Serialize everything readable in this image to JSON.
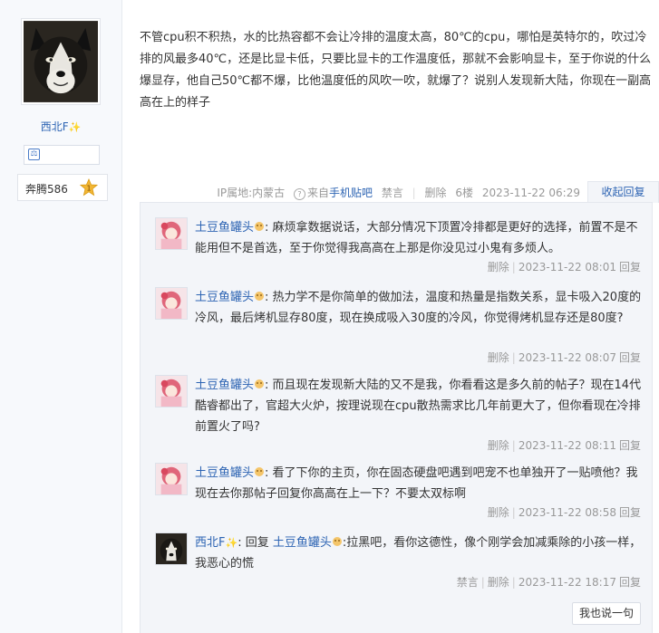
{
  "author": {
    "name": "西北F",
    "level_name": "奔腾586",
    "level_number": "1"
  },
  "post": {
    "body": "不管cpu积不积热，水的比热容都不会让冷排的温度太高，80℃的cpu，哪怕是英特尔的，吹过冷排的风最多40℃，还是比显卡低，只要比显卡的工作温度低，那就不会影响显卡，至于你说的什么爆显存，他自己50℃都不爆，比他温度低的风吹一吹，就爆了？说别人发现新大陆，你现在一副高高在上的样子",
    "ip_location": "IP属地:内蒙古",
    "source_prefix": "来自",
    "source_link": "手机贴吧",
    "ban": "禁言",
    "delete": "删除",
    "floor": "6楼",
    "time": "2023-11-22 06:29",
    "collapse_reply": "收起回复"
  },
  "replies": [
    {
      "user": "土豆鱼罐头",
      "text": ": 麻烦拿数据说话，大部分情况下顶置冷排都是更好的选择，前置不是不能用但不是首选，至于你觉得我高高在上那是你没见过小鬼有多烦人。",
      "delete": "删除",
      "time": "2023-11-22 08:01",
      "reply": "回复"
    },
    {
      "user": "土豆鱼罐头",
      "text": ": 热力学不是你简单的做加法，温度和热量是指数关系，显卡吸入20度的冷风，最后烤机显存80度，现在换成吸入30度的冷风，你觉得烤机显存还是80度?",
      "delete": "删除",
      "time": "2023-11-22 08:07",
      "reply": "回复"
    },
    {
      "user": "土豆鱼罐头",
      "text": ": 而且现在发现新大陆的又不是我，你看看这是多久前的帖子？现在14代酷睿都出了，官超大火炉，按理说现在cpu散热需求比几年前更大了，但你看现在冷排前置火了吗?",
      "delete": "删除",
      "time": "2023-11-22 08:11",
      "reply": "回复"
    },
    {
      "user": "土豆鱼罐头",
      "text": ": 看了下你的主页，你在固态硬盘吧遇到吧宠不也单独开了一贴喷他？我现在去你那帖子回复你高高在上一下？不要太双标啊",
      "delete": "删除",
      "time": "2023-11-22 08:58",
      "reply": "回复"
    },
    {
      "user": "西北F",
      "reply_word": ": 回复",
      "target": "土豆鱼罐头",
      "text": ":拉黑吧，看你这德性，像个刚学会加减乘除的小孩一样，我恶心的慌",
      "ban": "禁言",
      "delete": "删除",
      "time": "2023-11-22 18:17",
      "reply": "回复"
    }
  ],
  "say_button": "我也说一句",
  "colors": {
    "link": "#2d64b3",
    "meta": "#999999",
    "reply_bg": "#f3f5f9"
  }
}
